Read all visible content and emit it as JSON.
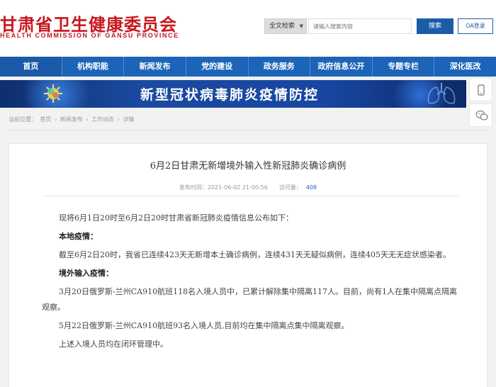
{
  "header": {
    "title": "甘肃省卫生健康委员会",
    "subtitle": "HEALTH COMMISSION OF GANSU PROVINCE",
    "search_scope": "全文检索",
    "search_placeholder": "请输入搜索内容",
    "search_button": "搜索",
    "oa_button": "OA登录"
  },
  "nav": {
    "items": [
      "首页",
      "机构职能",
      "新闻发布",
      "党的建设",
      "政务服务",
      "政府信息公开",
      "专题专栏",
      "深化医改"
    ]
  },
  "banner": {
    "text": "新型冠状病毒肺炎疫情防控"
  },
  "side_tools": {
    "icons": [
      "mobile-icon",
      "wechat-icon"
    ]
  },
  "breadcrumb": {
    "prefix": "当前位置：",
    "items": [
      "首页",
      "新闻发布",
      "工作动态",
      "详情"
    ],
    "separator": "›"
  },
  "article": {
    "title": "6月2日甘肃无新增境外输入性新冠肺炎确诊病例",
    "publish_label": "发布时间：",
    "publish_time": "2021-06-02 21:00:56",
    "views_label": "访问量：",
    "views": "408",
    "paragraphs": [
      {
        "type": "text",
        "text": "现将6月1日20时至6月2日20时甘肃省新冠肺炎疫情信息公布如下："
      },
      {
        "type": "head",
        "text": "本地疫情："
      },
      {
        "type": "text",
        "text": "截至6月2日20时，我省已连续423天无新增本土确诊病例，连续431天无疑似病例，连续405天无无症状感染者。"
      },
      {
        "type": "head",
        "text": "境外输入疫情："
      },
      {
        "type": "text",
        "text": "3月20日俄罗斯-兰州CA910航班118名入境人员中，已累计解除集中隔离117人。目前，尚有1人在集中隔离点隔离观察。"
      },
      {
        "type": "text",
        "text": "5月22日俄罗斯-兰州CA910航班93名入境人员,目前均在集中隔离点集中隔离观察。"
      },
      {
        "type": "text",
        "text": "上述入境人员均在闭环管理中。"
      }
    ]
  },
  "colors": {
    "brand_red": "#c8161d",
    "nav_blue": "#1c64b8",
    "button_blue": "#1b5ca8"
  }
}
